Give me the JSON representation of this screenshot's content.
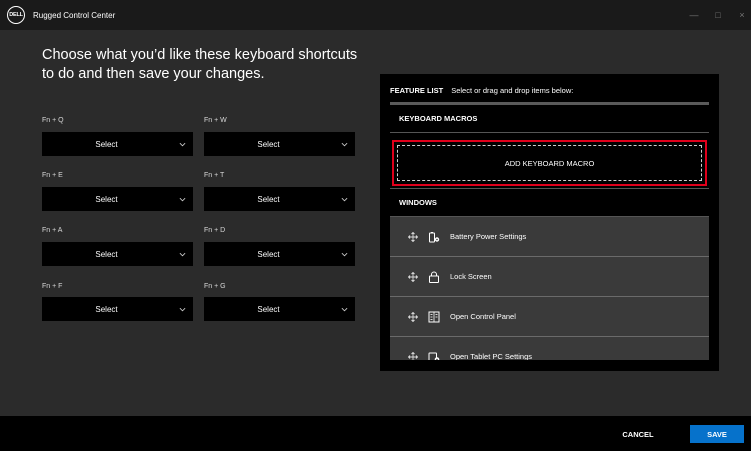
{
  "window": {
    "logo_text": "DELL",
    "title": "Rugged Control Center",
    "controls": {
      "minimize": "—",
      "maximize": "□",
      "close": "×"
    }
  },
  "heading": "Choose what you’d like these keyboard shortcuts to do and then save your changes.",
  "shortcuts": [
    {
      "key": "Fn + Q",
      "value": "Select"
    },
    {
      "key": "Fn + W",
      "value": "Select"
    },
    {
      "key": "Fn + E",
      "value": "Select"
    },
    {
      "key": "Fn + T",
      "value": "Select"
    },
    {
      "key": "Fn + A",
      "value": "Select"
    },
    {
      "key": "Fn + D",
      "value": "Select"
    },
    {
      "key": "Fn + F",
      "value": "Select"
    },
    {
      "key": "Fn + G",
      "value": "Select"
    }
  ],
  "feature_list": {
    "title": "FEATURE LIST",
    "subtitle": "Select or drag and drop items below:",
    "macros_heading": "KEYBOARD MACROS",
    "add_macro_label": "ADD KEYBOARD MACRO",
    "windows_heading": "WINDOWS",
    "windows_items": [
      {
        "label": "Battery Power Settings",
        "icon": "battery-settings-icon"
      },
      {
        "label": "Lock Screen",
        "icon": "lock-icon"
      },
      {
        "label": "Open Control Panel",
        "icon": "control-panel-icon"
      },
      {
        "label": "Open Tablet PC Settings",
        "icon": "tablet-settings-icon"
      }
    ]
  },
  "footer": {
    "cancel_label": "CANCEL",
    "save_label": "SAVE"
  },
  "colors": {
    "accent": "#0672cb",
    "highlight": "#e0001b",
    "background": "#2b2b2b",
    "panel": "#000000"
  }
}
